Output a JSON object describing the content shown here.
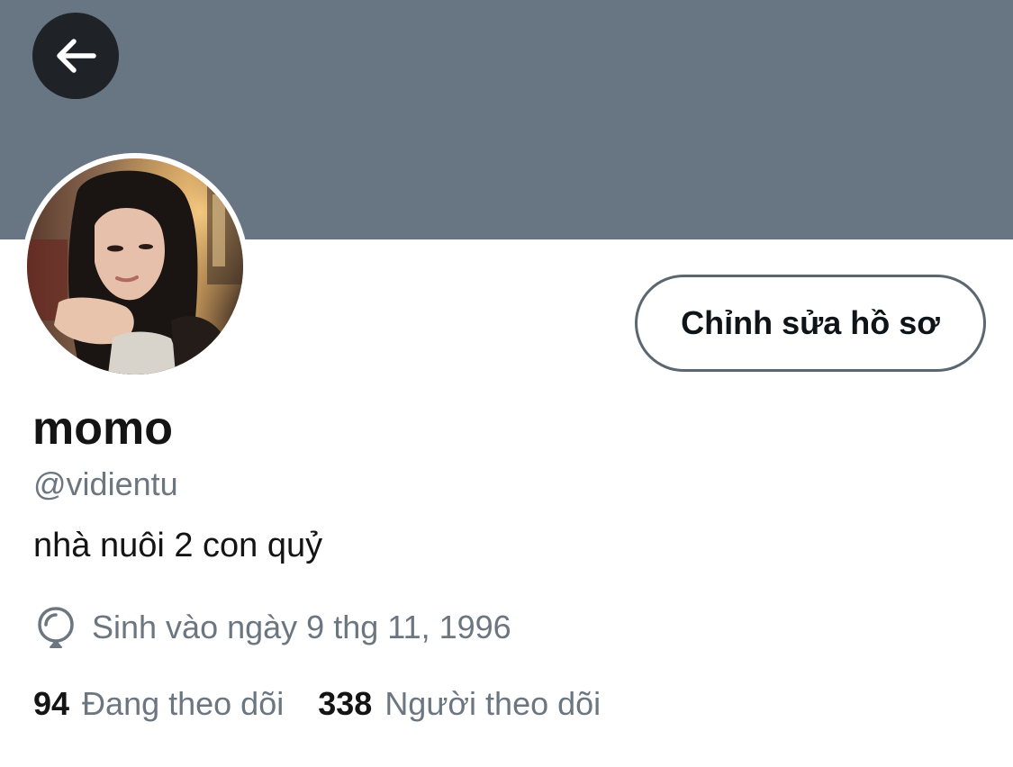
{
  "header": {
    "banner_color": "#687684",
    "back_icon": "arrow-left-icon"
  },
  "profile": {
    "display_name": "momo",
    "handle": "@vidientu",
    "bio": "nhà nuôi 2 con quỷ",
    "birthday_icon": "balloon-icon",
    "birthday": "Sinh vào ngày 9 thg 11, 1996",
    "edit_button": "Chỉnh sửa hồ sơ"
  },
  "stats": {
    "following_count": "94",
    "following_label": "Đang theo dõi",
    "followers_count": "338",
    "followers_label": "Người theo dõi"
  }
}
